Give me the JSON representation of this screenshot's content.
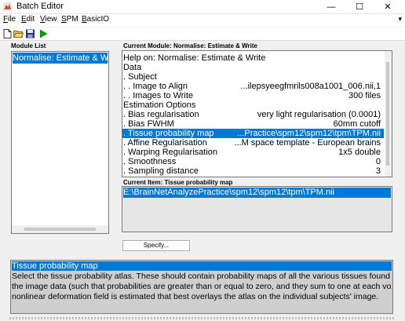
{
  "window": {
    "title": "Batch Editor",
    "controls": {
      "minimize": "—",
      "maximize": "☐",
      "close": "✕"
    }
  },
  "menu": {
    "items": [
      {
        "label": "File"
      },
      {
        "label": "Edit"
      },
      {
        "label": "View"
      },
      {
        "label": "SPM"
      },
      {
        "label": "BasicIO"
      }
    ],
    "overflow": "▾"
  },
  "toolbar": {
    "buttons": [
      "new-document-icon",
      "open-folder-icon",
      "save-icon",
      "run-icon"
    ],
    "run_color": "#00a000"
  },
  "module_list": {
    "label": "Module List",
    "items": [
      "Normalise: Estimate & Write"
    ]
  },
  "current_module": {
    "label": "Current Module: Normalise: Estimate & Write",
    "rows": [
      {
        "label": "Help on: Normalise: Estimate & Write",
        "value": ""
      },
      {
        "label": "Data",
        "value": ""
      },
      {
        "label": ". Subject",
        "value": ""
      },
      {
        "label": ". . Image to Align",
        "value": "...ilepsyeegfmrils008a1001_006.nii,1"
      },
      {
        "label": ". . Images to Write",
        "value": "300 files"
      },
      {
        "label": "Estimation Options",
        "value": ""
      },
      {
        "label": ". Bias regularisation",
        "value": "very light regularisation (0.0001)"
      },
      {
        "label": ". Bias FWHM",
        "value": "60mm cutoff"
      },
      {
        "label": ". Tissue probability map",
        "value": "...Practice\\spm12\\spm12\\tpm\\TPM.nii"
      },
      {
        "label": ". Affine Regularisation",
        "value": "...M space template - European brains"
      },
      {
        "label": ". Warping Regularisation",
        "value": "1x5 double"
      },
      {
        "label": ". Smoothness",
        "value": "0"
      },
      {
        "label": ". Sampling distance",
        "value": "3"
      }
    ],
    "selected_index": 8
  },
  "current_item": {
    "label": "Current Item: Tissue probability map",
    "value": "E:\\BrainNetAnalyzePractice\\spm12\\spm12\\tpm\\TPM.nii"
  },
  "specify_button": {
    "label": "Specify..."
  },
  "help": {
    "title": "Tissue probability map",
    "lines": [
      "Select  the  tissue  probability  atlas.  These should contain probability maps of all the various tissues found in",
      "the image data (such that probabilities are greater than or equal to zero, and they sum to one at each voxel. A",
      "nonlinear deformation field is estimated that best overlays the atlas on the individual subjects' image."
    ]
  },
  "colors": {
    "selection": "#0078d7",
    "help_background": "#cfcfcf",
    "item_background": "#e6e6e6"
  }
}
